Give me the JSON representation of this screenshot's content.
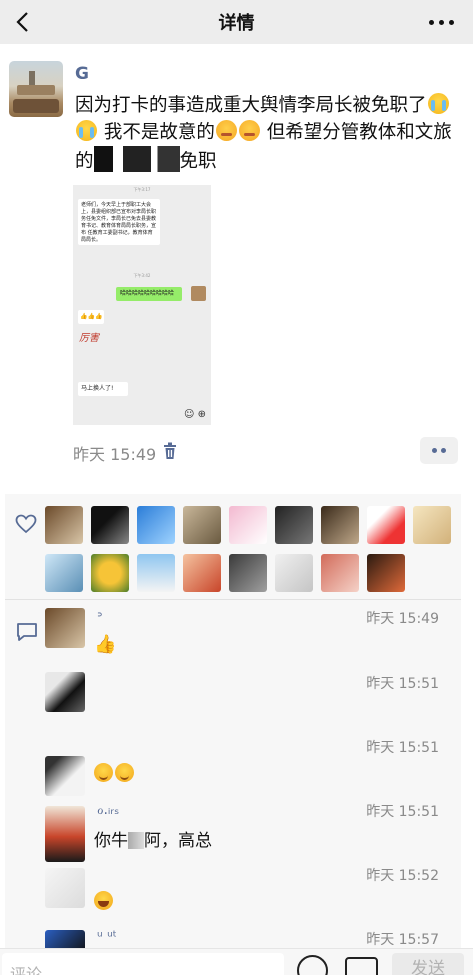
{
  "navbar": {
    "title": "详情"
  },
  "post": {
    "author": "G",
    "text_1": "因为打卡的事造成重大舆情李局长被免职了",
    "text_2": " 我不是故意的",
    "text_3": "  但希望分管教体和文旅的",
    "text_4": "免职",
    "time": "昨天 15:49"
  },
  "screenshot": {
    "time_top": "下午3:17",
    "msg_1": "老师们，今天早上于部职工大会上，县委组织部已宣布对李局长职务任免文件，李局长已免去县委教育书记、教育体育局局长职务，宣布 任教育工委副书记，教育体育局局长。",
    "time_mid": "下午3:42",
    "msg_2": "哈哈哈哈哈哈哈哈哈",
    "msg_3": "👍👍👍",
    "sticker": "厉害",
    "msg_4": "马上换人了!"
  },
  "comments": [
    {
      "name": "ᐣ",
      "time": "昨天 15:49",
      "text": "👍"
    },
    {
      "name": "",
      "time": "昨天 15:51",
      "text": ""
    },
    {
      "name": "",
      "time": "昨天 15:51",
      "text": ""
    },
    {
      "name": "ℴ.ᵢᵣₛ",
      "time": "昨天 15:51",
      "text_a": "你牛",
      "text_b": "阿，高总"
    },
    {
      "name": "",
      "time": "昨天 15:52",
      "text": ""
    },
    {
      "name": "ᵘ ᵘᵗ",
      "time": "昨天 15:57",
      "text": ""
    }
  ],
  "inputbar": {
    "placeholder": "评论",
    "send_label": "发送"
  }
}
